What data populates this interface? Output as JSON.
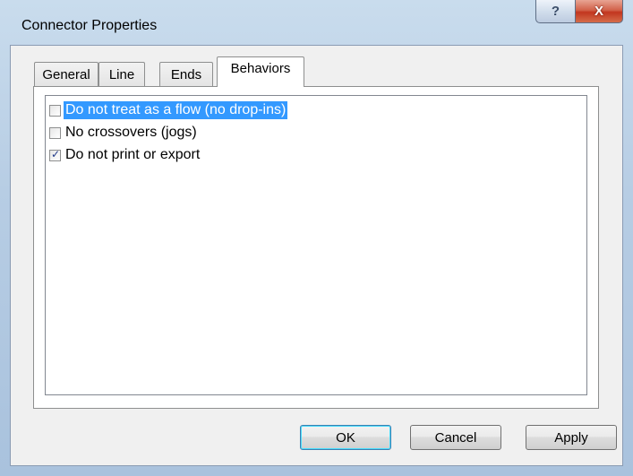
{
  "window": {
    "title": "Connector Properties",
    "help_glyph": "?",
    "close_glyph": "X"
  },
  "tabs": [
    {
      "label": "General",
      "active": false
    },
    {
      "label": "Line",
      "active": false
    },
    {
      "label": "Ends",
      "active": false
    },
    {
      "label": "Behaviors",
      "active": true
    }
  ],
  "options": [
    {
      "label": "Do not treat as a flow (no drop-ins)",
      "checked": false,
      "selected": true
    },
    {
      "label": "No crossovers (jogs)",
      "checked": false,
      "selected": false
    },
    {
      "label": "Do not print or export",
      "checked": true,
      "selected": false
    }
  ],
  "buttons": {
    "ok": "OK",
    "cancel": "Cancel",
    "apply": "Apply"
  },
  "colors": {
    "selection": "#3399ff",
    "close_button": "#c2361f"
  }
}
